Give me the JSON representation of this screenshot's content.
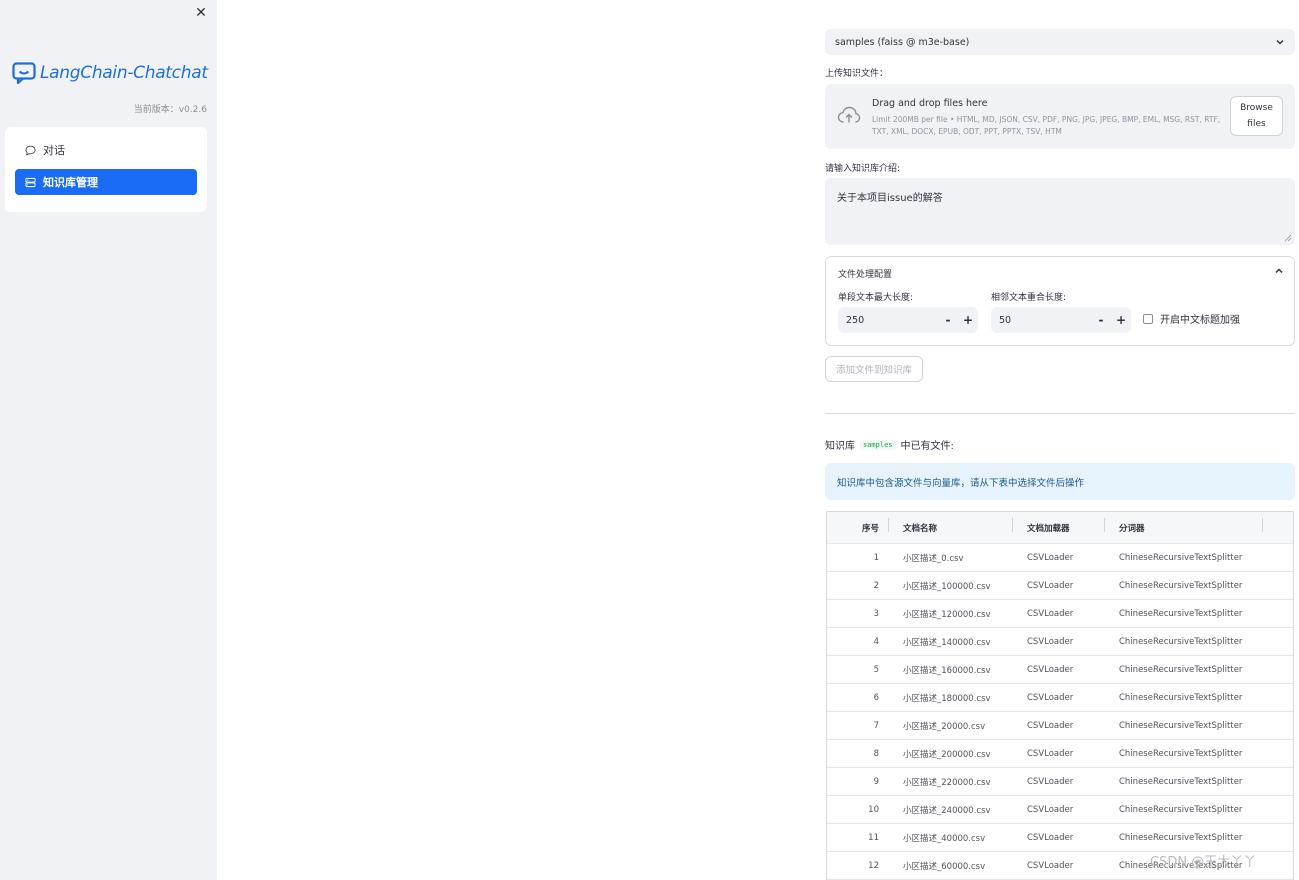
{
  "sidebar": {
    "close_glyph": "✕",
    "app_name": "LangChain-Chatchat",
    "version": "当前版本：v0.2.6",
    "nav": [
      {
        "label": "对话",
        "icon": "chat-bubble-icon",
        "active": false
      },
      {
        "label": "知识库管理",
        "icon": "database-icon",
        "active": true
      }
    ]
  },
  "main": {
    "kb_select": {
      "value": "samples (faiss @ m3e-base)"
    },
    "upload_label": "上传知识文件：",
    "uploader": {
      "title": "Drag and drop files here",
      "limit": "Limit 200MB per file • HTML, MD, JSON, CSV, PDF, PNG, JPG, JPEG, BMP, EML, MSG, RST, RTF, TXT, XML, DOCX, EPUB, ODT, PPT, PPTX, TSV, HTM",
      "browse_line1": "Browse",
      "browse_line2": "files"
    },
    "intro_label": "请输入知识库介绍:",
    "intro_value": "关于本项目issue的解答",
    "file_config": {
      "title": "文件处理配置",
      "chunk_label": "单段文本最大长度:",
      "chunk_value": "250",
      "overlap_label": "相邻文本重合长度:",
      "overlap_value": "50",
      "minus": "-",
      "plus": "+",
      "zh_title_label": "开启中文标题加强"
    },
    "add_button": "添加文件到知识库",
    "kb_files_prefix": "知识库",
    "kb_files_code": "samples",
    "kb_files_suffix": "中已有文件:",
    "info": "知识库中包含源文件与向量库，请从下表中选择文件后操作"
  },
  "table": {
    "headers": [
      "序号",
      "文档名称",
      "文档加载器",
      "分词器"
    ],
    "rows": [
      [
        "1",
        "小区描述_0.csv",
        "CSVLoader",
        "ChineseRecursiveTextSplitter"
      ],
      [
        "2",
        "小区描述_100000.csv",
        "CSVLoader",
        "ChineseRecursiveTextSplitter"
      ],
      [
        "3",
        "小区描述_120000.csv",
        "CSVLoader",
        "ChineseRecursiveTextSplitter"
      ],
      [
        "4",
        "小区描述_140000.csv",
        "CSVLoader",
        "ChineseRecursiveTextSplitter"
      ],
      [
        "5",
        "小区描述_160000.csv",
        "CSVLoader",
        "ChineseRecursiveTextSplitter"
      ],
      [
        "6",
        "小区描述_180000.csv",
        "CSVLoader",
        "ChineseRecursiveTextSplitter"
      ],
      [
        "7",
        "小区描述_20000.csv",
        "CSVLoader",
        "ChineseRecursiveTextSplitter"
      ],
      [
        "8",
        "小区描述_200000.csv",
        "CSVLoader",
        "ChineseRecursiveTextSplitter"
      ],
      [
        "9",
        "小区描述_220000.csv",
        "CSVLoader",
        "ChineseRecursiveTextSplitter"
      ],
      [
        "10",
        "小区描述_240000.csv",
        "CSVLoader",
        "ChineseRecursiveTextSplitter"
      ],
      [
        "11",
        "小区描述_40000.csv",
        "CSVLoader",
        "ChineseRecursiveTextSplitter"
      ],
      [
        "12",
        "小区描述_60000.csv",
        "CSVLoader",
        "ChineseRecursiveTextSplitter"
      ]
    ]
  },
  "watermark": "CSDN @王大丫丫",
  "colors": {
    "accent": "#1a6cf5",
    "sidebar_bg": "#f0f2f6",
    "info_bg": "#e6f2fc"
  }
}
